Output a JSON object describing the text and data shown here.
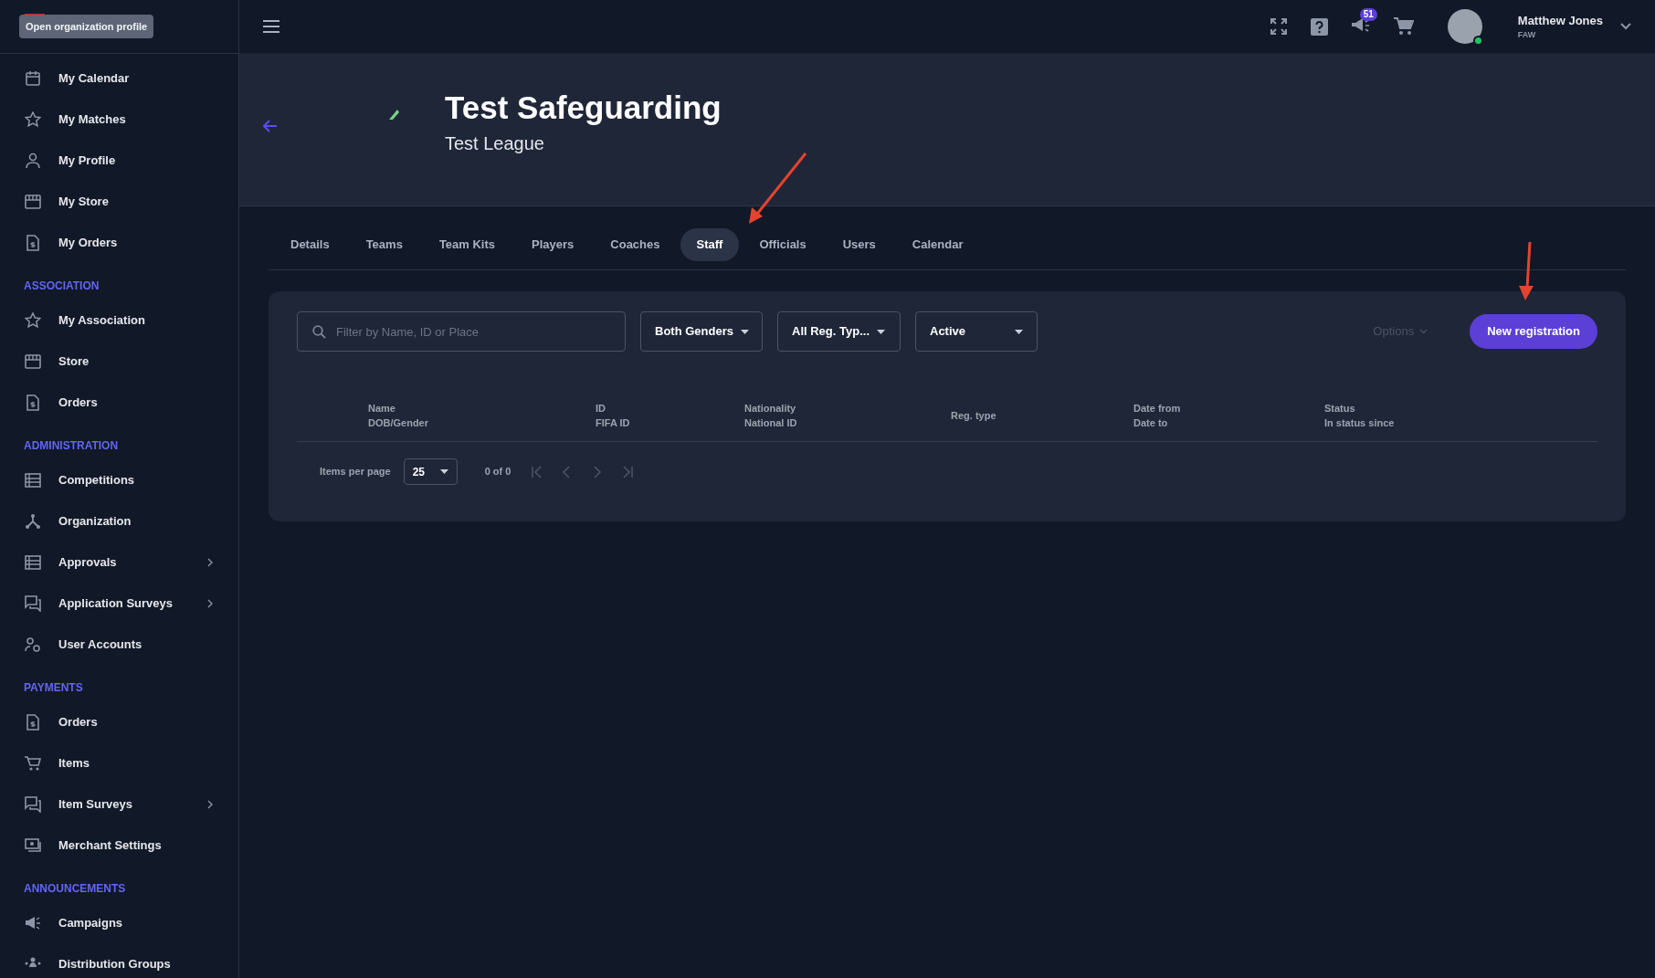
{
  "sidebar": {
    "tooltip": "Open organization profile",
    "sections": [
      {
        "items": [
          {
            "label": "My Calendar",
            "submenu": false
          },
          {
            "label": "My Matches",
            "submenu": false
          },
          {
            "label": "My Profile",
            "submenu": false
          },
          {
            "label": "My Store",
            "submenu": false
          },
          {
            "label": "My Orders",
            "submenu": false
          }
        ]
      },
      {
        "heading": "ASSOCIATION",
        "items": [
          {
            "label": "My Association",
            "submenu": false
          },
          {
            "label": "Store",
            "submenu": false
          },
          {
            "label": "Orders",
            "submenu": false
          }
        ]
      },
      {
        "heading": "ADMINISTRATION",
        "items": [
          {
            "label": "Competitions",
            "submenu": false
          },
          {
            "label": "Organization",
            "submenu": false
          },
          {
            "label": "Approvals",
            "submenu": true
          },
          {
            "label": "Application Surveys",
            "submenu": true
          },
          {
            "label": "User Accounts",
            "submenu": false
          }
        ]
      },
      {
        "heading": "PAYMENTS",
        "items": [
          {
            "label": "Orders",
            "submenu": false
          },
          {
            "label": "Items",
            "submenu": false
          },
          {
            "label": "Item Surveys",
            "submenu": true
          },
          {
            "label": "Merchant Settings",
            "submenu": false
          }
        ]
      },
      {
        "heading": "ANNOUNCEMENTS",
        "items": [
          {
            "label": "Campaigns",
            "submenu": false
          },
          {
            "label": "Distribution Groups",
            "submenu": false
          }
        ]
      }
    ]
  },
  "top_bar": {
    "notifications_badge": "51",
    "user": {
      "name": "Matthew Jones",
      "organization": "FAW",
      "online": true
    }
  },
  "header": {
    "title": "Test Safeguarding",
    "subtitle": "Test League"
  },
  "tabs": [
    {
      "label": "Details",
      "selected": false
    },
    {
      "label": "Teams",
      "selected": false
    },
    {
      "label": "Team Kits",
      "selected": false
    },
    {
      "label": "Players",
      "selected": false
    },
    {
      "label": "Coaches",
      "selected": false
    },
    {
      "label": "Staff",
      "selected": true
    },
    {
      "label": "Officials",
      "selected": false
    },
    {
      "label": "Users",
      "selected": false
    },
    {
      "label": "Calendar",
      "selected": false
    }
  ],
  "filters": {
    "search": {
      "placeholder": "Filter by Name, ID or Place"
    },
    "dropdowns": [
      "Both Genders",
      "All Reg. Typ...",
      "Active"
    ],
    "options": {
      "label": "Options",
      "disabled": true
    },
    "primary_button": "New registration"
  },
  "table": {
    "columns": [
      [
        "Name",
        "DOB/Gender"
      ],
      [
        "ID",
        "FIFA ID"
      ],
      [
        "Nationality",
        "National ID"
      ],
      [
        "Reg. type"
      ],
      [
        "Date from",
        "Date to"
      ],
      [
        "Status",
        "In status since"
      ]
    ]
  },
  "pagination": {
    "items_per_page_label": "Items per page",
    "page_size": "25",
    "range": "0 of 0",
    "nav_disabled": true
  }
}
